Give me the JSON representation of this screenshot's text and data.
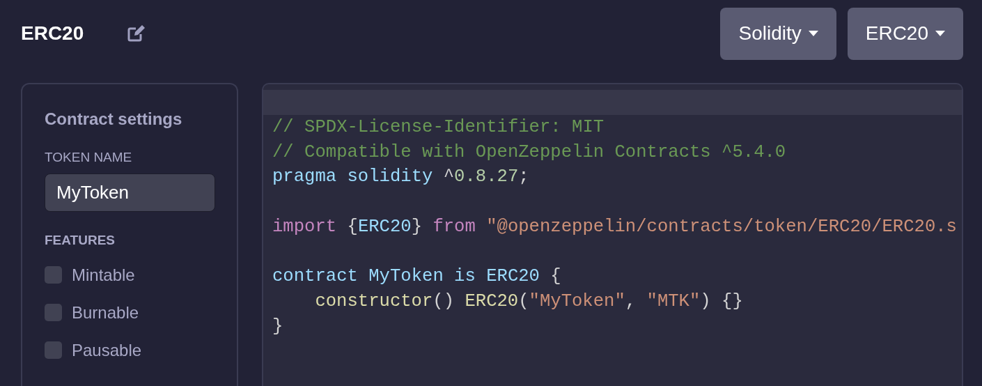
{
  "header": {
    "title": "ERC20",
    "dropdowns": [
      {
        "label": "Solidity"
      },
      {
        "label": "ERC20"
      }
    ]
  },
  "settings": {
    "title": "Contract settings",
    "token_name_label": "TOKEN NAME",
    "token_name": "MyToken",
    "features_label": "FEATURES",
    "features": [
      {
        "label": "Mintable",
        "checked": false
      },
      {
        "label": "Burnable",
        "checked": false
      },
      {
        "label": "Pausable",
        "checked": false
      }
    ]
  },
  "code": [
    {
      "tokens": [
        {
          "kind": "comment",
          "text": "// SPDX-License-Identifier: MIT"
        }
      ]
    },
    {
      "tokens": [
        {
          "kind": "comment",
          "text": "// Compatible with OpenZeppelin Contracts ^5.4.0"
        }
      ]
    },
    {
      "blank_after": true,
      "tokens": [
        {
          "kind": "keyword",
          "text": "pragma solidity"
        },
        {
          "kind": "plain",
          "text": " ^"
        },
        {
          "kind": "number",
          "text": "0.8.27"
        },
        {
          "kind": "plain",
          "text": ";"
        }
      ]
    },
    {
      "blank_after": true,
      "tokens": [
        {
          "kind": "import",
          "text": "import"
        },
        {
          "kind": "plain",
          "text": " {"
        },
        {
          "kind": "keyword",
          "text": "ERC20"
        },
        {
          "kind": "plain",
          "text": "} "
        },
        {
          "kind": "import",
          "text": "from"
        },
        {
          "kind": "string",
          "text": " \"@openzeppelin/contracts/token/ERC20/ERC20.s"
        }
      ]
    },
    {
      "tokens": [
        {
          "kind": "keyword",
          "text": "contract MyToken is ERC20"
        },
        {
          "kind": "plain",
          "text": " {"
        }
      ]
    },
    {
      "indent": true,
      "tokens": [
        {
          "kind": "func",
          "text": "constructor"
        },
        {
          "kind": "plain",
          "text": "() "
        },
        {
          "kind": "func",
          "text": "ERC20"
        },
        {
          "kind": "plain",
          "text": "("
        },
        {
          "kind": "string",
          "text": "\"MyToken\""
        },
        {
          "kind": "plain",
          "text": ", "
        },
        {
          "kind": "string",
          "text": "\"MTK\""
        },
        {
          "kind": "plain",
          "text": ") {}"
        }
      ]
    },
    {
      "tokens": [
        {
          "kind": "plain",
          "text": "}"
        }
      ]
    }
  ]
}
